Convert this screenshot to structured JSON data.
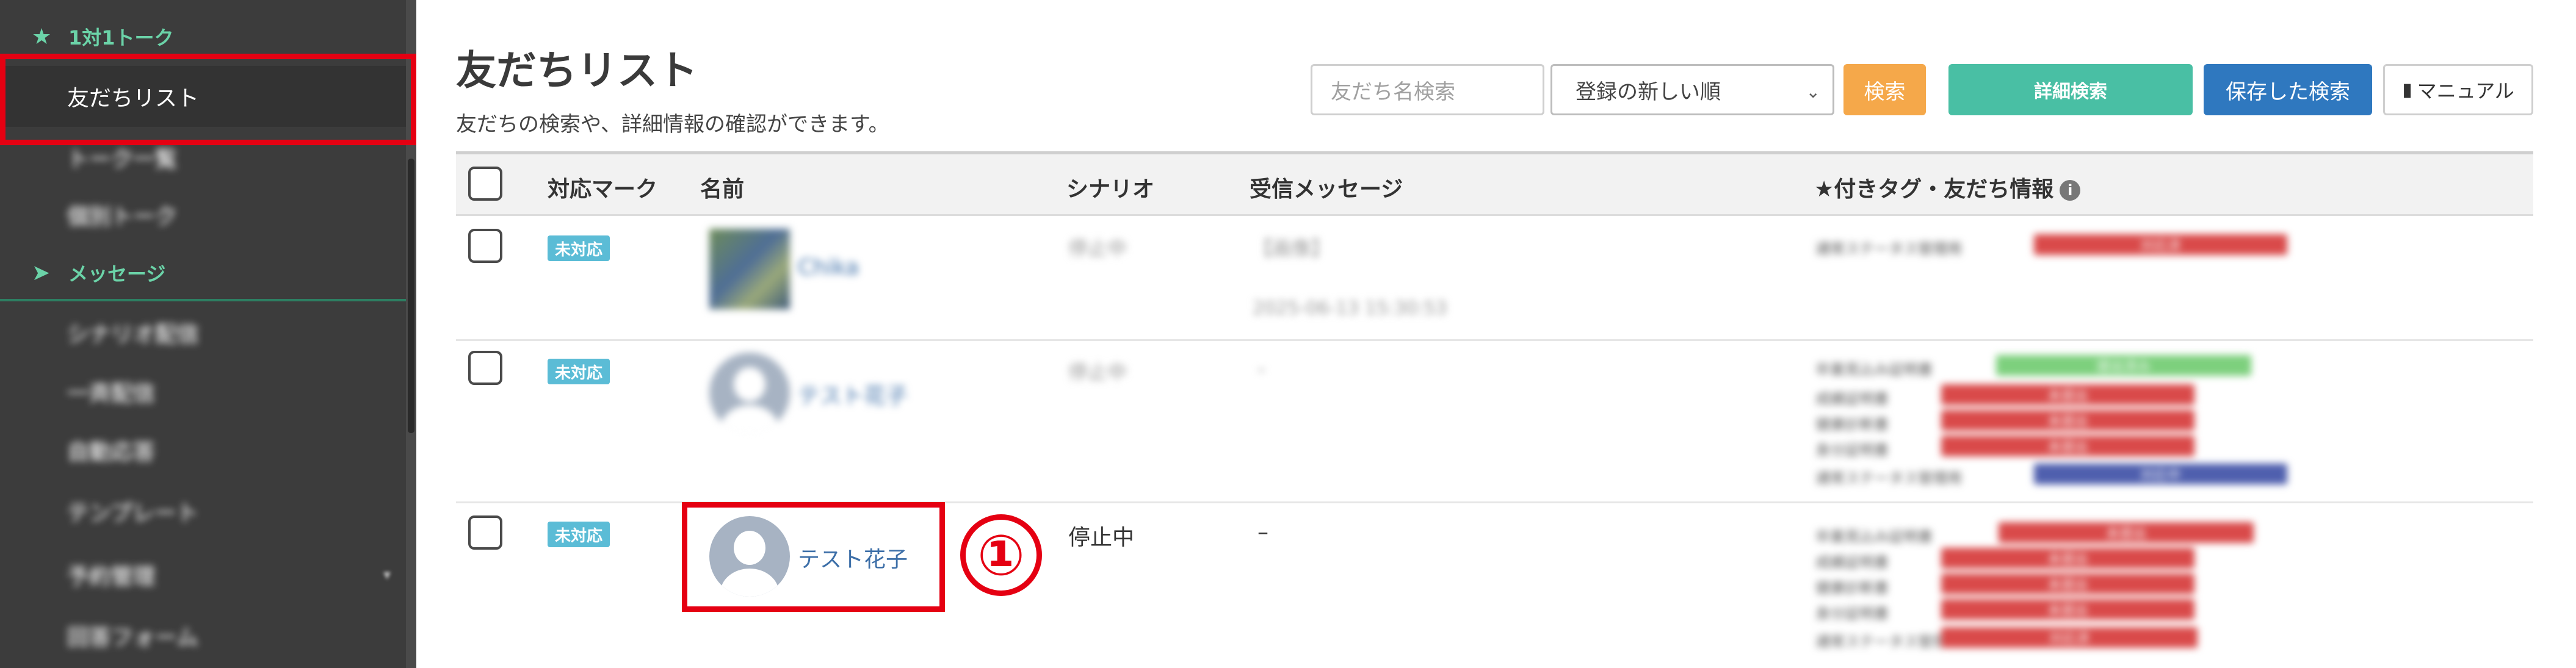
{
  "sidebar": {
    "section_talk": {
      "label": "1対1トーク",
      "icon": "star-icon"
    },
    "section_message": {
      "label": "メッセージ",
      "icon": "send-icon"
    },
    "items": [
      {
        "label": "友だちリスト",
        "active": true
      },
      {
        "label": "トーク一覧"
      },
      {
        "label": "個別トーク"
      },
      {
        "label": "シナリオ配信"
      },
      {
        "label": "一斉配信"
      },
      {
        "label": "自動応答"
      },
      {
        "label": "テンプレート"
      },
      {
        "label": "予約管理"
      },
      {
        "label": "回答フォーム"
      }
    ]
  },
  "page": {
    "title": "友だちリスト",
    "subtitle": "友だちの検索や、詳細情報の確認ができます。"
  },
  "toolbar": {
    "search_placeholder": "友だち名検索",
    "sort_selected": "登録の新しい順",
    "search_button": "検索",
    "detail_search_button": "詳細検索",
    "saved_search_button": "保存した検索",
    "manual_button": "マニュアル"
  },
  "table": {
    "headers": {
      "mark": "対応マーク",
      "name": "名前",
      "scenario": "シナリオ",
      "message": "受信メッセージ",
      "tags": "★付きタグ・友だち情報"
    },
    "rows": [
      {
        "badge": "未対応",
        "name": "Chika",
        "scenario": "停止中",
        "message": "【画像】",
        "message_time": "2025-06-13 15:30:53",
        "tags": [
          {
            "label": "通常ステータス管理用",
            "value": "対応済",
            "color": "#d94a4a"
          }
        ]
      },
      {
        "badge": "未対応",
        "name": "テスト花子",
        "scenario": "停止中",
        "message": "-",
        "tags": [
          {
            "label": "卒業見込み証明書",
            "value": "提出済み",
            "color": "#7dd07d"
          },
          {
            "label": "成績証明書",
            "value": "未提出",
            "color": "#d94a4a"
          },
          {
            "label": "健康診断書",
            "value": "未提出",
            "color": "#d94a4a"
          },
          {
            "label": "身分証明書",
            "value": "未提出",
            "color": "#d94a4a"
          },
          {
            "label": "通常ステータス管理用",
            "value": "対応中",
            "color": "#4f5fae"
          }
        ]
      },
      {
        "badge": "未対応",
        "name": "テスト花子",
        "scenario": "停止中",
        "message": "–",
        "tags": [
          {
            "label": "卒業見込み証明書",
            "value": "未提出",
            "color": "#d94a4a"
          },
          {
            "label": "成績証明書",
            "value": "未提出",
            "color": "#d94a4a"
          },
          {
            "label": "健康診断書",
            "value": "未提出",
            "color": "#d94a4a"
          },
          {
            "label": "身分証明書",
            "value": "未提出",
            "color": "#d94a4a"
          },
          {
            "label": "通常ステータス管理用",
            "value": "対応済",
            "color": "#d94a4a"
          }
        ]
      }
    ]
  },
  "annotation": {
    "marker": "①",
    "color": "#e50012"
  }
}
